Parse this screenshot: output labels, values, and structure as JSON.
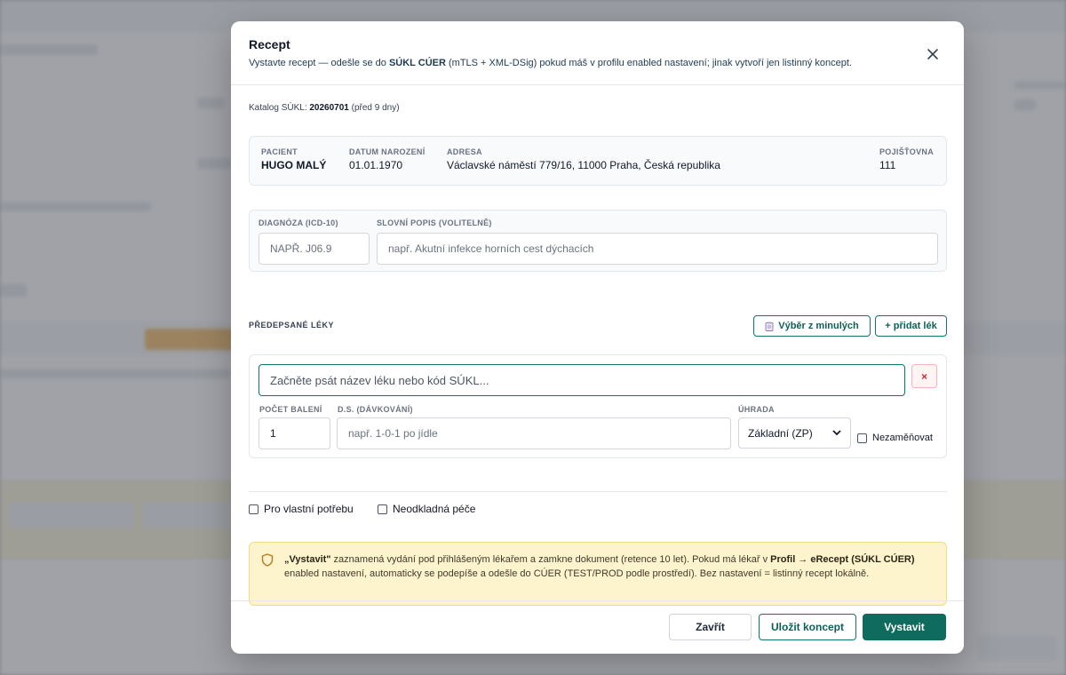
{
  "modal": {
    "title": "Recept",
    "subtitle_prefix": "Vystavte recept — odešle se do ",
    "subtitle_bold": "SÚKL CÚER",
    "subtitle_suffix": " (mTLS + XML-DSig) pokud máš v profilu enabled nastavení; jinak vytvoří jen listinný koncept.",
    "close_icon": "close-icon"
  },
  "catalog": {
    "label": "Katalog SÚKL: ",
    "version": "20260701",
    "age": " (před 9 dny)"
  },
  "patient": {
    "name_label": "PACIENT",
    "name": "HUGO MALÝ",
    "dob_label": "DATUM NAROZENÍ",
    "dob": "01.01.1970",
    "address_label": "ADRESA",
    "address": "Václavské náměstí 779/16, 11000 Praha, Česká republika",
    "insurer_label": "POJIŠŤOVNA",
    "insurer": "111"
  },
  "diagnosis": {
    "code_label": "DIAGNÓZA (ICD-10)",
    "code_value": "",
    "code_placeholder": "NAPŘ. J06.9",
    "desc_label": "SLOVNÍ POPIS (VOLITELNĚ)",
    "desc_value": "",
    "desc_placeholder": "např. Akutní infekce horních cest dýchacích"
  },
  "drugs": {
    "section_title": "PŘEDEPSANÉ LÉKY",
    "history_button": "Výběr z minulých",
    "history_icon": "clipboard-icon",
    "add_button": "+ přidat lék",
    "items": [
      {
        "search_placeholder": "Začněte psát název léku nebo kód SÚKL...",
        "remove_label": "×",
        "count_label": "POČET BALENÍ",
        "count_value": "1",
        "dosage_label": "D.S. (DÁVKOVÁNÍ)",
        "dosage_placeholder": "např. 1-0-1 po jídle",
        "payment_label": "ÚHRADA",
        "payment_value": "Základní (ZP)",
        "no_substitute_label": "Nezaměňovat",
        "no_substitute_checked": false
      }
    ]
  },
  "options": {
    "own_need_label": "Pro vlastní potřebu",
    "own_need_checked": false,
    "urgent_label": "Neodkladná péče",
    "urgent_checked": false
  },
  "notice": {
    "icon": "shield-icon",
    "part1": "„Vystavit\"",
    "part2": " zaznamená vydání pod přihlášeným lékařem a zamkne dokument (retence 10 let). Pokud má lékař v ",
    "part3": "Profil → eRecept (SÚKL CÚER)",
    "part4": " enabled nastavení, automaticky se podepíše a odešle do CÚER (TEST/PROD podle prostředí). Bez nastavení = listinný recept lokálně.",
    "colors": {
      "background": "#fdf3cd",
      "border": "#f3d98b"
    }
  },
  "footer": {
    "close_button": "Zavřít",
    "draft_button": "Uložit koncept",
    "issue_button": "Vystavit"
  },
  "colors": {
    "accent": "#0f766e",
    "primary_button": "#0f6b5e",
    "danger": "#dc2626"
  }
}
